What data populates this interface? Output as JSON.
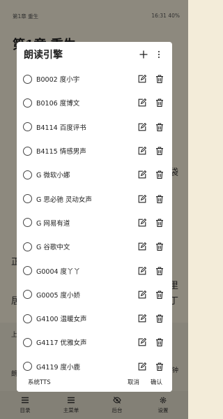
{
  "status_bar": {
    "left": "第1章 重生",
    "right": "16:31 40%"
  },
  "reader": {
    "chapter_title": "第1章 重生",
    "text_fragments": [
      "袋",
      "正",
      "里",
      "居",
      "丁",
      "上",
      "钟",
      "朗"
    ]
  },
  "dialog": {
    "title": "朗读引擎",
    "engines": [
      {
        "label": "B0002 度小宇",
        "selected": false
      },
      {
        "label": "B0106 度博文",
        "selected": false
      },
      {
        "label": "B4114 百度评书",
        "selected": false
      },
      {
        "label": "B4115 情感男声",
        "selected": false
      },
      {
        "label": "G 微软小娜",
        "selected": false
      },
      {
        "label": "G 思必驰 灵动女声",
        "selected": false
      },
      {
        "label": "G 网易有道",
        "selected": false
      },
      {
        "label": "G 谷歌中文",
        "selected": false
      },
      {
        "label": "G0004 度丫丫",
        "selected": false
      },
      {
        "label": "G0005 度小娇",
        "selected": false
      },
      {
        "label": "G4100 温暖女声",
        "selected": false
      },
      {
        "label": "G4117 优雅女声",
        "selected": false
      },
      {
        "label": "G4119 度小鹿",
        "selected": false
      }
    ],
    "footer": {
      "system_tts": "系统TTS",
      "cancel": "取消",
      "confirm": "确认"
    }
  },
  "bottom_nav": [
    {
      "label": "目录",
      "icon": "menu-lines-icon"
    },
    {
      "label": "主菜单",
      "icon": "menu-lines-icon"
    },
    {
      "label": "后台",
      "icon": "eye-off-icon"
    },
    {
      "label": "设置",
      "icon": "gear-icon"
    }
  ],
  "colors": {
    "paper": "#f3ecd9",
    "dialog_bg": "#ffffff",
    "text": "#222222"
  }
}
